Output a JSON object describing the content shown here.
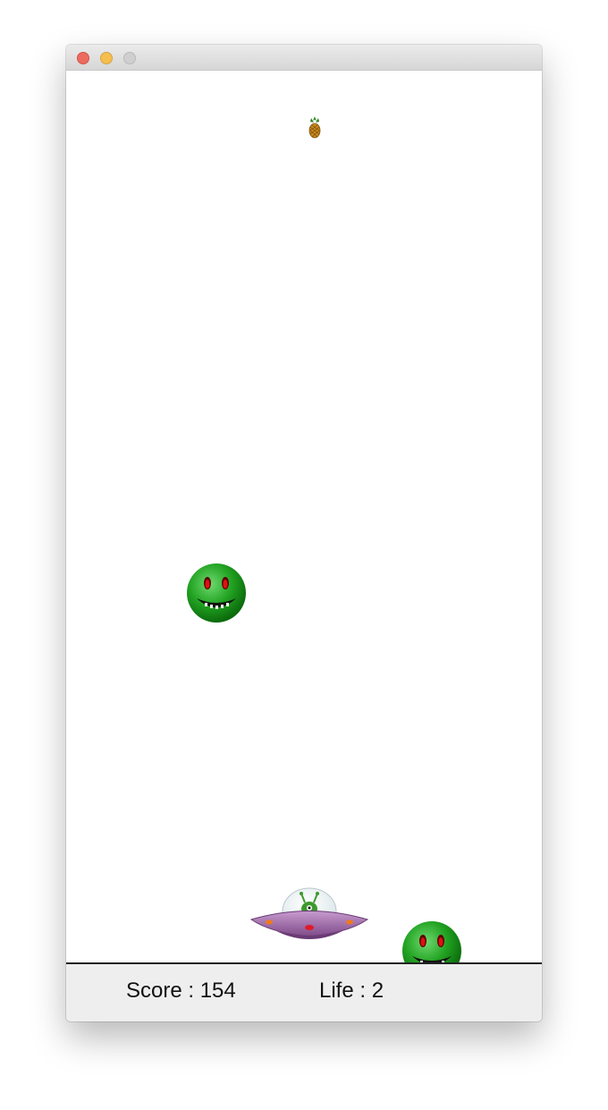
{
  "window": {
    "controls": [
      "close",
      "minimize",
      "zoom"
    ]
  },
  "hud": {
    "score_label": "Score : 154",
    "life_label": "Life : 2"
  },
  "sprites": {
    "pineapple": {
      "icon": "pineapple-icon"
    },
    "aliens": [
      {
        "icon": "green-alien-face-icon"
      },
      {
        "icon": "green-alien-face-icon"
      }
    ],
    "player": {
      "icon": "ufo-ship-icon"
    }
  },
  "colors": {
    "alien_green": "#1e9a1e",
    "ufo_purple": "#a068a8",
    "hud_background": "#eeeeee"
  }
}
